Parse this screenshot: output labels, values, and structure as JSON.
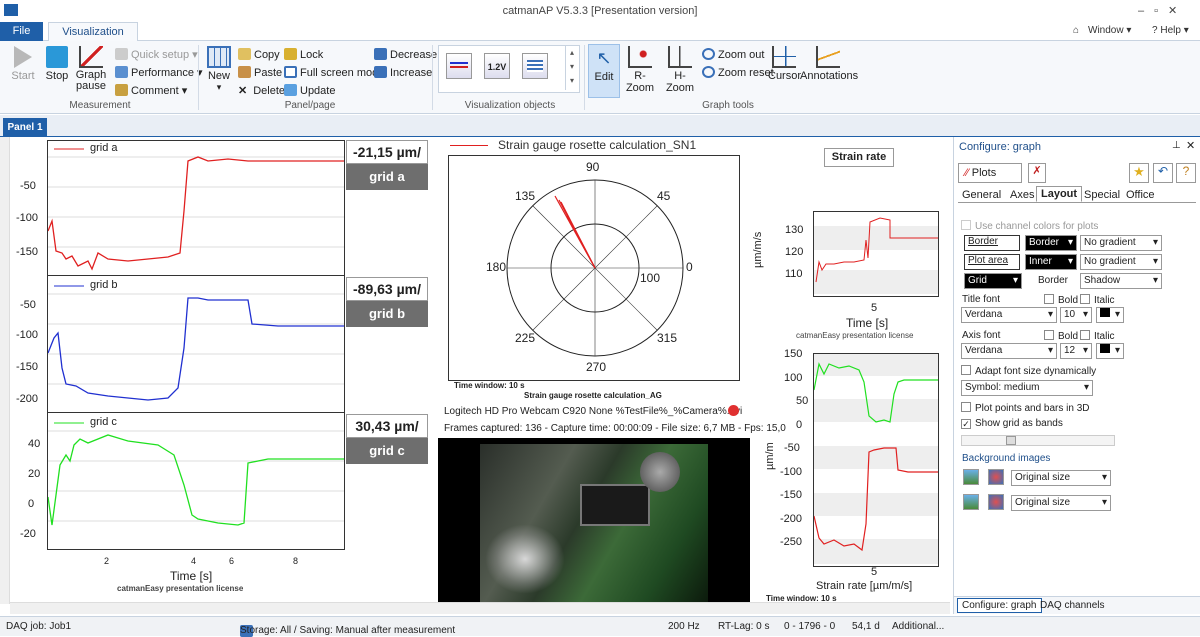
{
  "window": {
    "title": "catmanAP V5.3.3 [Presentation version]",
    "right_items": {
      "window": "Window",
      "help": "Help"
    }
  },
  "tabs": {
    "file": "File",
    "visualization": "Visualization"
  },
  "ribbon": {
    "start": "Start",
    "stop": "Stop",
    "graph_pause": "Graph pause",
    "quick_setup": "Quick setup",
    "performance": "Performance",
    "comment": "Comment",
    "measurement_group": "Measurement",
    "new": "New",
    "copy": "Copy",
    "paste": "Paste",
    "delete": "Delete",
    "lock": "Lock",
    "full_screen": "Full screen mode",
    "update": "Update",
    "decrease": "Decrease",
    "increase": "Increase",
    "panel_group": "Panel/page",
    "viz_objects_group": "Visualization objects",
    "edit": "Edit",
    "r_zoom": "R-Zoom",
    "h_zoom": "H-Zoom",
    "zoom_out": "Zoom out",
    "zoom_reset": "Zoom reset",
    "cursor": "Cursor",
    "annotations": "Annotations",
    "graph_tools_group": "Graph tools"
  },
  "panel": {
    "tab": "Panel 1"
  },
  "left_graphs": {
    "license": "catmanEasy presentation license",
    "xlabel": "Time  [s]",
    "xticks": [
      "2",
      "4",
      "6",
      "8"
    ],
    "grids": [
      {
        "legend": "grid a",
        "value": "-21,15 µm/",
        "button": "grid a",
        "color": "#e02020",
        "yticks": [
          "-50",
          "-100",
          "-150"
        ]
      },
      {
        "legend": "grid b",
        "value": "-89,63 µm/",
        "button": "grid b",
        "color": "#2030d0",
        "yticks": [
          "-50",
          "-100",
          "-150",
          "-200"
        ]
      },
      {
        "legend": "grid c",
        "value": "30,43 µm/",
        "button": "grid c",
        "color": "#20e020",
        "yticks": [
          "40",
          "20",
          "0",
          "-20"
        ]
      }
    ]
  },
  "polar": {
    "title": "Strain gauge rosette calculation_SN1",
    "angles": [
      "90",
      "45",
      "0",
      "315",
      "270",
      "225",
      "180",
      "135"
    ],
    "radial": "100",
    "time_window": "Time window: 10 s",
    "footer": "Strain gauge rosette calculation_AG"
  },
  "camera": {
    "info": "Logitech HD Pro Webcam C920   None   %TestFile%_%Camera%.avi",
    "frames": "Frames captured: 136 - Capture time: 00:00:09 - File size: 6,7 MB - Fps: 15,0"
  },
  "strain_rate": {
    "title": "Strain rate",
    "top": {
      "ylabel": "µm/m/s",
      "yticks": [
        "130",
        "120",
        "110"
      ],
      "xtick": "5",
      "xlabel": "Time  [s]",
      "license": "catmanEasy presentation license"
    },
    "bottom": {
      "ylabel": "µm/m",
      "yticks": [
        "150",
        "100",
        "50",
        "0",
        "-50",
        "-100",
        "-150",
        "-200",
        "-250"
      ],
      "xtick": "5",
      "xlabel": "Strain rate   [µm/m/s]",
      "time_window": "Time window: 10 s"
    }
  },
  "config": {
    "title": "Configure: graph",
    "plots": "Plots",
    "tabs": [
      "General",
      "Axes",
      "Layout",
      "Special",
      "Office"
    ],
    "use_channel_colors": "Use channel colors for plots",
    "border": "Border",
    "border_sel": "Border",
    "no_gradient": "No gradient",
    "plot_area": "Plot area",
    "inner": "Inner",
    "no_gradient2": "No gradient",
    "grid": "Grid",
    "border_label": "Border",
    "shadow": "Shadow",
    "title_font": "Title font",
    "bold": "Bold",
    "italic": "Italic",
    "font1": "Verdana",
    "size1": "10",
    "axis_font": "Axis font",
    "font2": "Verdana",
    "size2": "12",
    "adapt": "Adapt font size dynamically",
    "symbol": "Symbol: medium",
    "plot3d": "Plot points and bars in 3D",
    "grid_bands": "Show grid as bands",
    "bg_images": "Background images",
    "orig1": "Original size",
    "orig2": "Original size",
    "bottom_tabs": [
      "Configure: graph",
      "DAQ channels"
    ]
  },
  "status": {
    "job": "DAQ job: Job1",
    "storage": "Storage: All / Saving: Manual after measurement",
    "rate": "200 Hz",
    "lag": "RT-Lag: 0 s",
    "counter": "0 - 1796 - 0",
    "disk": "54,1 d",
    "additional": "Additional..."
  },
  "colors": {
    "accent": "#1f5fa8",
    "red": "#e02020",
    "blue": "#2030d0",
    "green": "#20e020"
  }
}
